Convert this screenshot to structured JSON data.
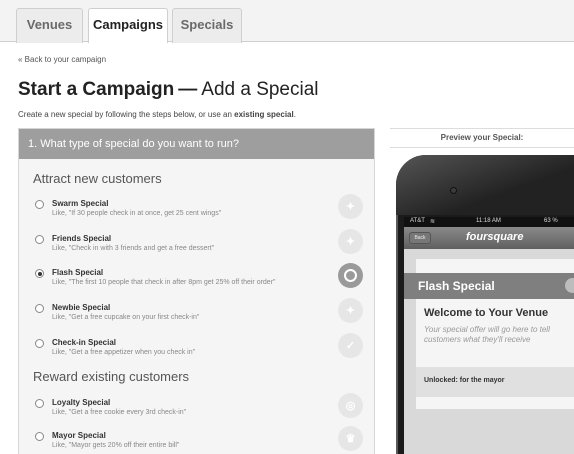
{
  "tabs": [
    {
      "label": "Venues",
      "active": false
    },
    {
      "label": "Campaigns",
      "active": true
    },
    {
      "label": "Specials",
      "active": false
    }
  ],
  "back_link": "« Back to your campaign",
  "title": {
    "main": "Start a Campaign",
    "dash": "—",
    "sub": "Add a Special"
  },
  "intro": {
    "text": "Create a new special by following the steps below, or use an ",
    "link": "existing special",
    "end": "."
  },
  "question": "1. What type of special do you want to run?",
  "sections": [
    {
      "title": "Attract new customers",
      "options": [
        {
          "name": "Swarm Special",
          "desc": "Like, \"If 30 people check in at once, get 25 cent wings\"",
          "icon": "swarm-icon",
          "selected": false
        },
        {
          "name": "Friends Special",
          "desc": "Like, \"Check in with 3 friends and get a free dessert\"",
          "icon": "friends-icon",
          "selected": false
        },
        {
          "name": "Flash Special",
          "desc": "Like, \"The first 10 people that check in after 8pm get 25% off their order\"",
          "icon": "flash-icon",
          "selected": true
        },
        {
          "name": "Newbie Special",
          "desc": "Like, \"Get a free cupcake on your first check-in\"",
          "icon": "newbie-icon",
          "selected": false
        },
        {
          "name": "Check-in Special",
          "desc": "Like, \"Get a free appetizer when you check in\"",
          "icon": "checkin-icon",
          "selected": false
        }
      ]
    },
    {
      "title": "Reward existing customers",
      "options": [
        {
          "name": "Loyalty Special",
          "desc": "Like, \"Get a free cookie every 3rd check-in\"",
          "icon": "loyalty-icon",
          "selected": false
        },
        {
          "name": "Mayor Special",
          "desc": "Like, \"Mayor gets 20% off their entire bill\"",
          "icon": "mayor-crown-icon",
          "selected": false
        }
      ]
    }
  ],
  "preview": {
    "title": "Preview your Special:",
    "carrier": "AT&T",
    "time": "11:18 AM",
    "battery": "63 %",
    "back": "Back",
    "brand": "foursquare",
    "special_name": "Flash Special",
    "venue": "Welcome to Your Venue",
    "message": "Your special offer will go here to tell customers what they'll receive",
    "unlock": "Unlocked: for the mayor"
  }
}
